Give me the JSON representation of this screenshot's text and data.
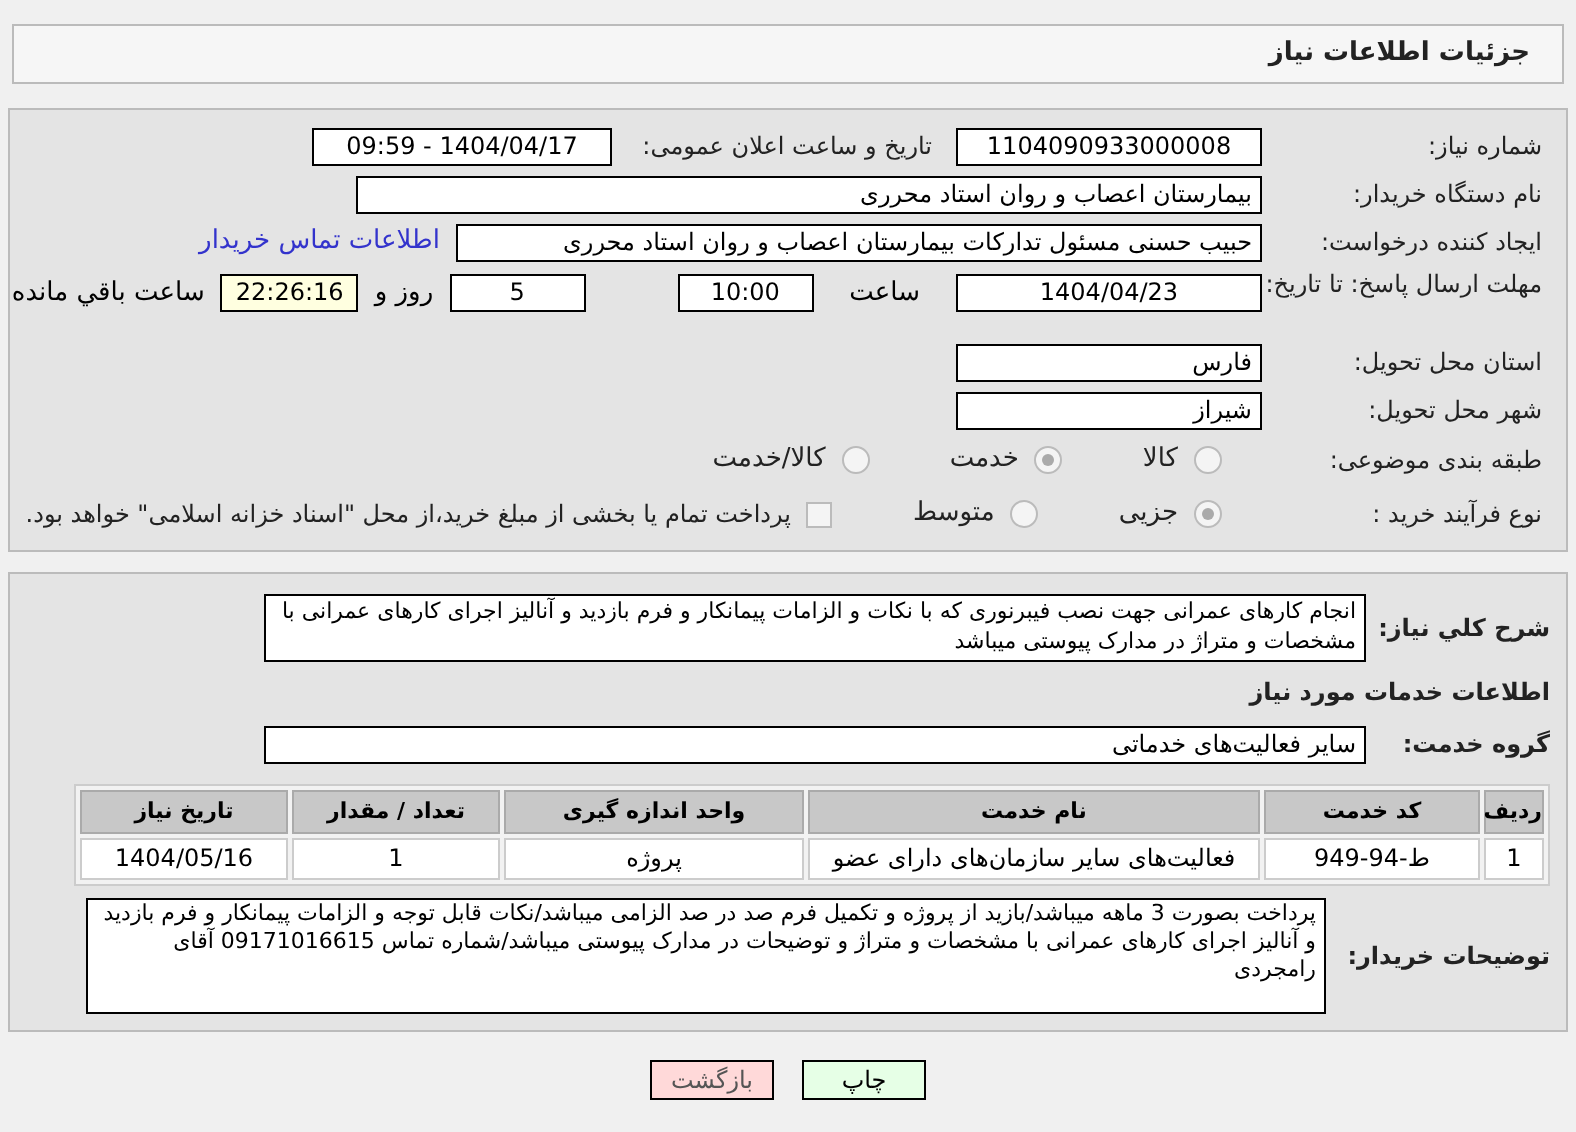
{
  "header": {
    "title": "جزئیات اطلاعات نیاز"
  },
  "details": {
    "need_number": {
      "label": "شماره نیاز:",
      "value": "1104090933000008"
    },
    "announce": {
      "label": "تاریخ و ساعت اعلان عمومی:",
      "value": "1404/04/17 - 09:59"
    },
    "buyer_org": {
      "label": "نام دستگاه خریدار:",
      "value": "بیمارستان اعصاب و روان استاد محرری"
    },
    "creator": {
      "label": "ایجاد کننده درخواست:",
      "value": "حبیب حسنی مسئول تدارکات بیمارستان اعصاب و روان استاد محرری",
      "link": "اطلاعات تماس خریدار"
    },
    "deadline": {
      "label": "مهلت ارسال پاسخ: تا تاریخ:",
      "date": "1404/04/23",
      "time_label": "ساعت",
      "time": "10:00",
      "days": "5",
      "days_label": "روز و",
      "remaining": "22:26:16",
      "remaining_label": "ساعت باقي مانده"
    },
    "province": {
      "label": "استان محل تحویل:",
      "value": "فارس"
    },
    "city": {
      "label": "شهر محل تحویل:",
      "value": "شیراز"
    },
    "category": {
      "label": "طبقه بندی موضوعی:",
      "options": [
        {
          "label": "کالا",
          "selected": false
        },
        {
          "label": "خدمت",
          "selected": true
        },
        {
          "label": "کالا/خدمت",
          "selected": false
        }
      ]
    },
    "process": {
      "label": "نوع فرآیند خرید :",
      "options": [
        {
          "label": "جزیی",
          "selected": true
        },
        {
          "label": "متوسط",
          "selected": false
        }
      ],
      "treasury": {
        "label": "پرداخت تمام یا بخشی از مبلغ خرید،از محل \"اسناد خزانه اسلامی\" خواهد بود.",
        "checked": false
      }
    }
  },
  "services": {
    "description": {
      "label": "شرح کلي نياز:",
      "value": "انجام کارهای عمرانی جهت نصب فیبرنوری که با نکات و الزامات پیمانکار و فرم بازدید و آنالیز اجرای کارهای عمرانی با مشخصات و متراژ در مدارک پیوستی میباشد"
    },
    "heading": "اطلاعات خدمات مورد نياز",
    "group": {
      "label": "گروه خدمت:",
      "value": "سایر فعالیت‌های خدماتی"
    },
    "table": {
      "columns": [
        "ردیف",
        "کد خدمت",
        "نام خدمت",
        "واحد اندازه گیری",
        "تعداد / مقدار",
        "تاریخ نیاز"
      ],
      "rows": [
        [
          "1",
          "ط-94-949",
          "فعالیت‌های سایر سازمان‌های دارای عضو",
          "پروژه",
          "1",
          "1404/05/16"
        ]
      ]
    },
    "notes": {
      "label": "توضیحات خریدار:",
      "value": "پرداخت بصورت 3 ماهه میباشد/بازید از پروژه و تکمیل فرم صد در صد الزامی میباشد/نکات قابل توجه و الزامات پیمانکار و فرم بازدید و آنالیز اجرای کارهای عمرانی با مشخصات و متراژ و توضیحات در مدارک پیوستی میباشد/شماره تماس 09171016615 آقای رامجردی"
    }
  },
  "buttons": [
    {
      "label": "چاپ",
      "kind": "print"
    },
    {
      "label": "بازگشت",
      "kind": "back"
    }
  ]
}
